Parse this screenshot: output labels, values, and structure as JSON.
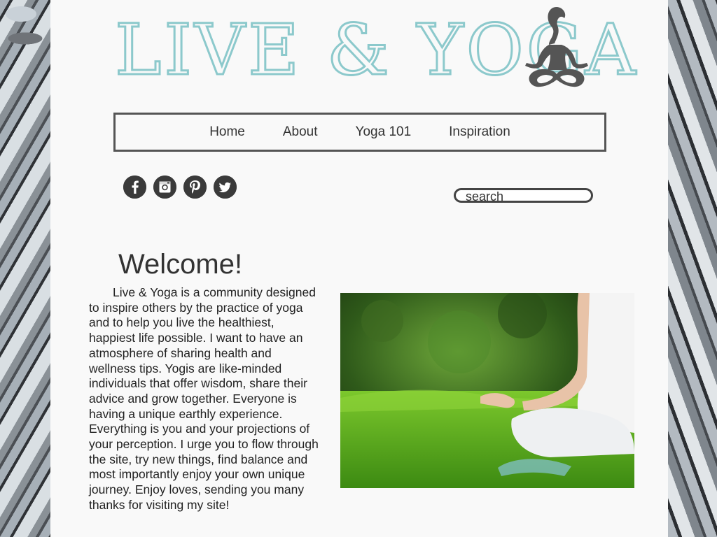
{
  "header": {
    "logo_text": "LIVE & YOGA",
    "logo_color": "#8cc9cc",
    "logo_icon": "meditating-figure-icon"
  },
  "nav": {
    "items": [
      {
        "label": "Home"
      },
      {
        "label": "About"
      },
      {
        "label": "Yoga 101"
      },
      {
        "label": "Inspiration"
      }
    ]
  },
  "social": {
    "items": [
      {
        "name": "facebook-icon",
        "glyph": "f"
      },
      {
        "name": "instagram-icon",
        "glyph": "◎"
      },
      {
        "name": "pinterest-icon",
        "glyph": "P"
      },
      {
        "name": "twitter-icon",
        "glyph": "🐦"
      }
    ]
  },
  "search": {
    "placeholder": "search"
  },
  "welcome": {
    "title": "Welcome!",
    "body": "Live & Yoga is a community designed to inspire others by the practice of yoga and to help you live the healthiest, happiest life possible. I want to have an atmosphere of sharing health and wellness tips. Yogis are like-minded individuals that offer wisdom, share their advice and grow together. Everyone is having a unique earthly experience. Everything is you and your projections of your perception. I urge you to flow through the site, try new things, find balance and most importantly enjoy your own unique journey. Enjoy loves, sending you many thanks for visiting my site!"
  },
  "photo": {
    "alt": "woman meditating on grass"
  }
}
